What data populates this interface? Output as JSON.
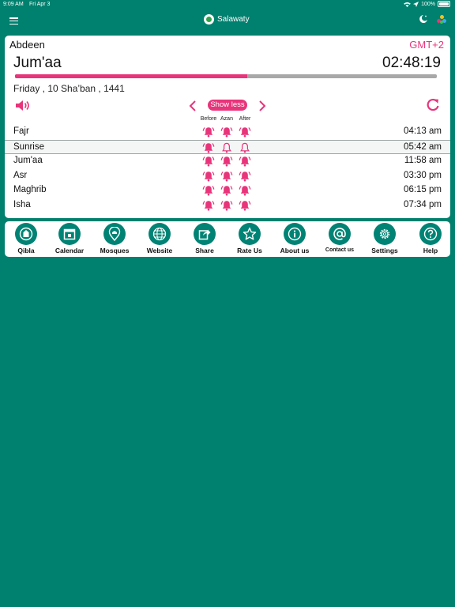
{
  "status_bar": {
    "time": "9:09 AM",
    "date": "Fri Apr 3",
    "battery": "100%"
  },
  "app": {
    "title": "Salawaty"
  },
  "colors": {
    "accent": "#e8347a",
    "teal": "#00806e",
    "button": "#008374"
  },
  "header": {
    "location": "Abdeen",
    "timezone": "GMT+2",
    "next_prayer": "Jum'aa",
    "countdown": "02:48:19",
    "progress": 0.55,
    "hijri_date": "Friday , 10 Sha’ban , 1441",
    "show_less_label": "Show less"
  },
  "columns": {
    "before": "Before",
    "azan": "Azan",
    "after": "After"
  },
  "prayers": [
    {
      "name": "Fajr",
      "time": "04:13 am",
      "before": "on",
      "azan": "on",
      "after": "on"
    },
    {
      "name": "Sunrise",
      "time": "05:42 am",
      "before": "on",
      "azan": "off",
      "after": "off"
    },
    {
      "name": "Jum'aa",
      "time": "11:58 am",
      "before": "on",
      "azan": "on",
      "after": "on"
    },
    {
      "name": "Asr",
      "time": "03:30 pm",
      "before": "on",
      "azan": "on",
      "after": "on"
    },
    {
      "name": "Maghrib",
      "time": "06:15 pm",
      "before": "on",
      "azan": "on",
      "after": "on"
    },
    {
      "name": "Isha",
      "time": "07:34 pm",
      "before": "on",
      "azan": "on",
      "after": "on"
    }
  ],
  "toolbar": [
    {
      "label": "Qibla",
      "icon": "qibla-icon"
    },
    {
      "label": "Calendar",
      "icon": "calendar-icon"
    },
    {
      "label": "Mosques",
      "icon": "mosque-pin-icon"
    },
    {
      "label": "Website",
      "icon": "globe-icon"
    },
    {
      "label": "Share",
      "icon": "share-icon"
    },
    {
      "label": "Rate Us",
      "icon": "star-icon"
    },
    {
      "label": "About us",
      "icon": "info-icon"
    },
    {
      "label": "Contact us",
      "icon": "at-icon"
    },
    {
      "label": "Settings",
      "icon": "gear-icon"
    },
    {
      "label": "Help",
      "icon": "help-icon"
    }
  ]
}
